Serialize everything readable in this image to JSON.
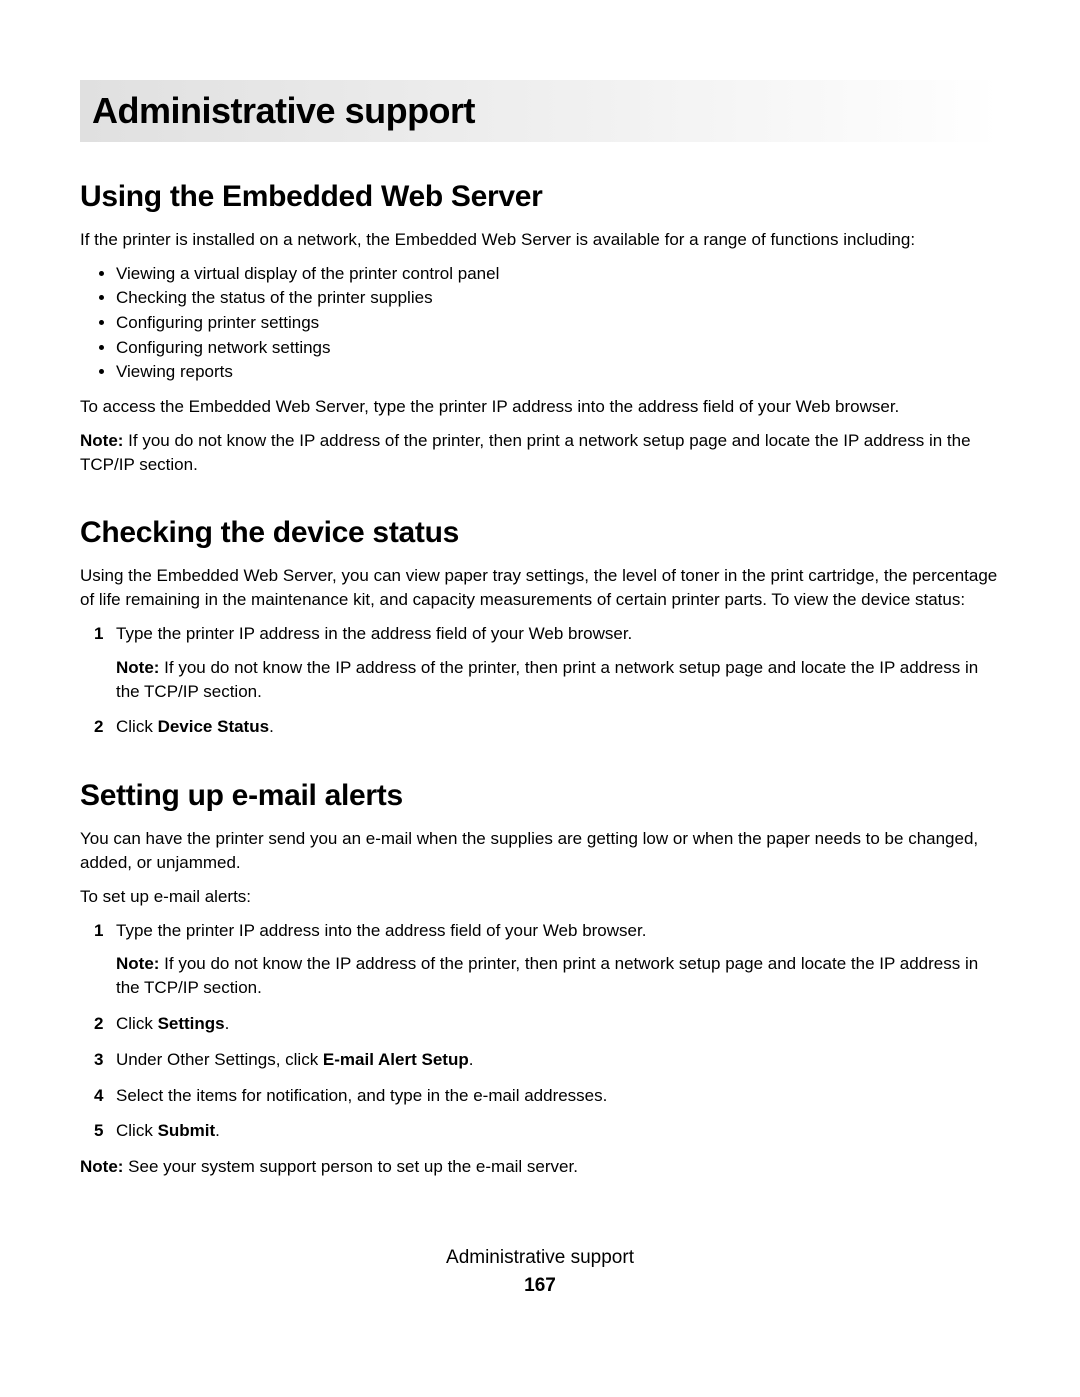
{
  "chapter": {
    "title": "Administrative support"
  },
  "section1": {
    "heading": "Using the Embedded Web Server",
    "intro": "If the printer is installed on a network, the Embedded Web Server is available for a range of functions including:",
    "bullets": [
      "Viewing a virtual display of the printer control panel",
      "Checking the status of the printer supplies",
      "Configuring printer settings",
      "Configuring network settings",
      "Viewing reports"
    ],
    "access": "To access the Embedded Web Server, type the printer IP address into the address field of your Web browser.",
    "note_label": "Note:",
    "note_body": " If you do not know the IP address of the printer, then print a network setup page and locate the IP address in the TCP/IP section."
  },
  "section2": {
    "heading": "Checking the device status",
    "intro": "Using the Embedded Web Server, you can view paper tray settings, the level of toner in the print cartridge, the percentage of life remaining in the maintenance kit, and capacity measurements of certain printer parts. To view the device status:",
    "step1_num": "1",
    "step1_text": "Type the printer IP address in the address field of your Web browser.",
    "step1_note_label": "Note:",
    "step1_note_body": " If you do not know the IP address of the printer, then print a network setup page and locate the IP address in the TCP/IP section.",
    "step2_num": "2",
    "step2_prefix": "Click ",
    "step2_bold": "Device Status",
    "step2_suffix": "."
  },
  "section3": {
    "heading": "Setting up e-mail alerts",
    "intro": "You can have the printer send you an e-mail when the supplies are getting low or when the paper needs to be changed, added, or unjammed.",
    "lead": "To set up e-mail alerts:",
    "step1_num": "1",
    "step1_text": "Type the printer IP address into the address field of your Web browser.",
    "step1_note_label": "Note:",
    "step1_note_body": " If you do not know the IP address of the printer, then print a network setup page and locate the IP address in the TCP/IP section.",
    "step2_num": "2",
    "step2_prefix": "Click ",
    "step2_bold": "Settings",
    "step2_suffix": ".",
    "step3_num": "3",
    "step3_prefix": "Under Other Settings, click ",
    "step3_bold": "E-mail Alert Setup",
    "step3_suffix": ".",
    "step4_num": "4",
    "step4_text": "Select the items for notification, and type in the e-mail addresses.",
    "step5_num": "5",
    "step5_prefix": "Click ",
    "step5_bold": "Submit",
    "step5_suffix": ".",
    "note_label": "Note:",
    "note_body": " See your system support person to set up the e-mail server."
  },
  "footer": {
    "title": "Administrative support",
    "page": "167"
  }
}
